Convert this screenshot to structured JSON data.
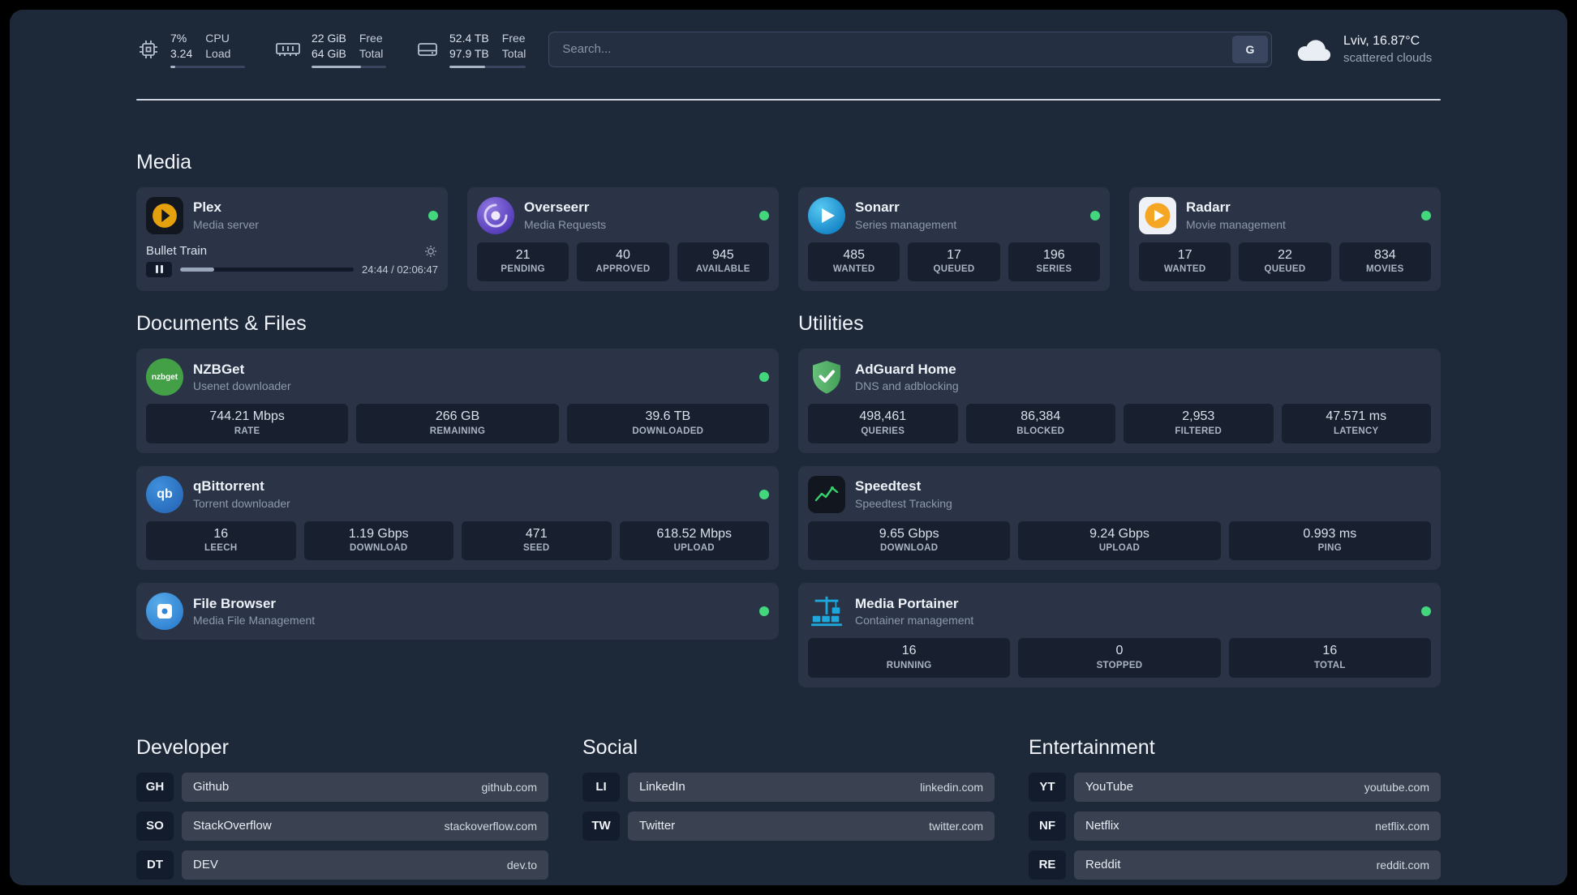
{
  "topbar": {
    "cpu": {
      "percent": "7%",
      "load": "3.24",
      "label1": "CPU",
      "label2": "Load",
      "progress": 7
    },
    "memory": {
      "free": "22 GiB",
      "total": "64 GiB",
      "label1": "Free",
      "label2": "Total",
      "progress": 66
    },
    "disk": {
      "free": "52.4 TB",
      "total": "97.9 TB",
      "label1": "Free",
      "label2": "Total",
      "progress": 47
    },
    "search": {
      "placeholder": "Search...",
      "button": "G"
    },
    "weather": {
      "location": "Lviv, 16.87°C",
      "condition": "scattered clouds"
    }
  },
  "media": {
    "title": "Media",
    "plex": {
      "name": "Plex",
      "desc": "Media server",
      "icon": "plex-icon",
      "status": "online",
      "now_playing": "Bullet Train",
      "time": "24:44 / 02:06:47",
      "progress": 19.5
    },
    "overseerr": {
      "name": "Overseerr",
      "desc": "Media Requests",
      "icon": "overseerr-icon",
      "status": "online",
      "stats": [
        {
          "value": "21",
          "label": "PENDING"
        },
        {
          "value": "40",
          "label": "APPROVED"
        },
        {
          "value": "945",
          "label": "AVAILABLE"
        }
      ]
    },
    "sonarr": {
      "name": "Sonarr",
      "desc": "Series management",
      "icon": "sonarr-icon",
      "status": "online",
      "stats": [
        {
          "value": "485",
          "label": "WANTED"
        },
        {
          "value": "17",
          "label": "QUEUED"
        },
        {
          "value": "196",
          "label": "SERIES"
        }
      ]
    },
    "radarr": {
      "name": "Radarr",
      "desc": "Movie management",
      "icon": "radarr-icon",
      "status": "online",
      "stats": [
        {
          "value": "17",
          "label": "WANTED"
        },
        {
          "value": "22",
          "label": "QUEUED"
        },
        {
          "value": "834",
          "label": "MOVIES"
        }
      ]
    }
  },
  "documents": {
    "title": "Documents & Files",
    "nzbget": {
      "name": "NZBGet",
      "desc": "Usenet downloader",
      "icon": "nzbget-icon",
      "status": "online",
      "stats": [
        {
          "value": "744.21 Mbps",
          "label": "RATE"
        },
        {
          "value": "266 GB",
          "label": "REMAINING"
        },
        {
          "value": "39.6 TB",
          "label": "DOWNLOADED"
        }
      ]
    },
    "qbittorrent": {
      "name": "qBittorrent",
      "desc": "Torrent downloader",
      "icon": "qbittorrent-icon",
      "status": "online",
      "stats": [
        {
          "value": "16",
          "label": "LEECH"
        },
        {
          "value": "1.19 Gbps",
          "label": "DOWNLOAD"
        },
        {
          "value": "471",
          "label": "SEED"
        },
        {
          "value": "618.52 Mbps",
          "label": "UPLOAD"
        }
      ]
    },
    "filebrowser": {
      "name": "File Browser",
      "desc": "Media File Management",
      "icon": "filebrowser-icon",
      "status": "online"
    }
  },
  "utilities": {
    "title": "Utilities",
    "adguard": {
      "name": "AdGuard Home",
      "desc": "DNS and adblocking",
      "icon": "adguard-icon",
      "stats": [
        {
          "value": "498,461",
          "label": "QUERIES"
        },
        {
          "value": "86,384",
          "label": "BLOCKED"
        },
        {
          "value": "2,953",
          "label": "FILTERED"
        },
        {
          "value": "47.571 ms",
          "label": "LATENCY"
        }
      ]
    },
    "speedtest": {
      "name": "Speedtest",
      "desc": "Speedtest Tracking",
      "icon": "speedtest-icon",
      "stats": [
        {
          "value": "9.65 Gbps",
          "label": "DOWNLOAD"
        },
        {
          "value": "9.24 Gbps",
          "label": "UPLOAD"
        },
        {
          "value": "0.993 ms",
          "label": "PING"
        }
      ]
    },
    "portainer": {
      "name": "Media Portainer",
      "desc": "Container management",
      "icon": "portainer-icon",
      "status": "online",
      "stats": [
        {
          "value": "16",
          "label": "RUNNING"
        },
        {
          "value": "0",
          "label": "STOPPED"
        },
        {
          "value": "16",
          "label": "TOTAL"
        }
      ]
    }
  },
  "bookmarks": {
    "developer": {
      "title": "Developer",
      "items": [
        {
          "abbr": "GH",
          "name": "Github",
          "url": "github.com"
        },
        {
          "abbr": "SO",
          "name": "StackOverflow",
          "url": "stackoverflow.com"
        },
        {
          "abbr": "DT",
          "name": "DEV",
          "url": "dev.to"
        }
      ]
    },
    "social": {
      "title": "Social",
      "items": [
        {
          "abbr": "LI",
          "name": "LinkedIn",
          "url": "linkedin.com"
        },
        {
          "abbr": "TW",
          "name": "Twitter",
          "url": "twitter.com"
        }
      ]
    },
    "entertainment": {
      "title": "Entertainment",
      "items": [
        {
          "abbr": "YT",
          "name": "YouTube",
          "url": "youtube.com"
        },
        {
          "abbr": "NF",
          "name": "Netflix",
          "url": "netflix.com"
        },
        {
          "abbr": "RE",
          "name": "Reddit",
          "url": "reddit.com"
        }
      ]
    }
  },
  "colors": {
    "status_online": "#42d77d",
    "page_background": "#1d2839",
    "card_background": "#2a3446",
    "plex_brand": "#e5a00d",
    "sonarr_brand": "#35c5f4",
    "overseerr_brand": "#5f3bb3",
    "adguard_brand": "#5fbf6e",
    "portainer_brand": "#1ea7dc"
  }
}
